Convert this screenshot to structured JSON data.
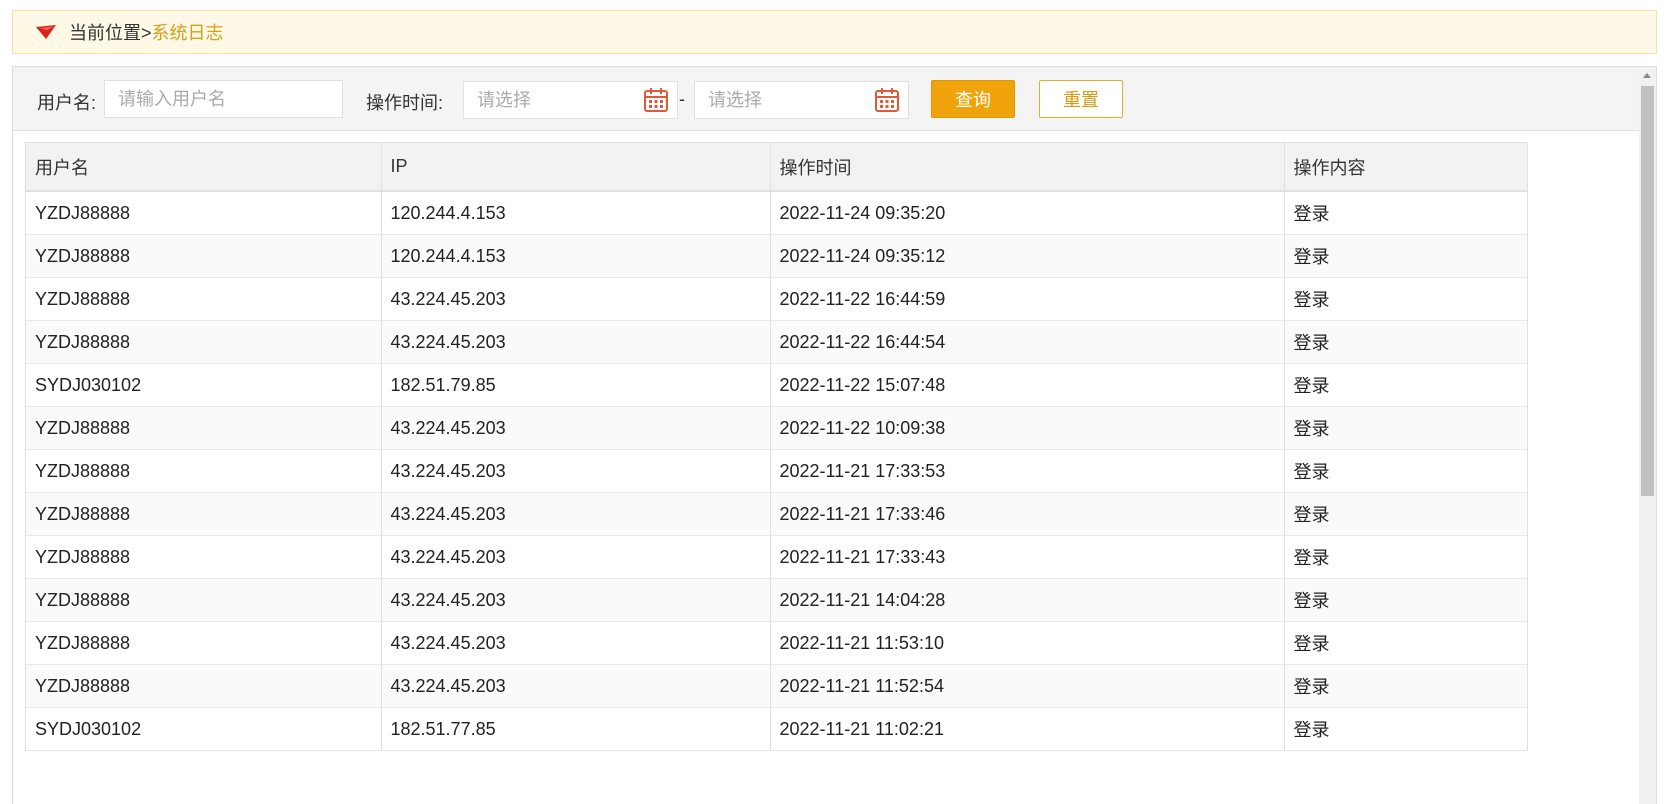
{
  "breadcrumb": {
    "prefix": "当前位置>",
    "current": "系统日志",
    "icon": "red-arrow-icon"
  },
  "search": {
    "username_label": "用户名:",
    "username_placeholder": "请输入用户名",
    "username_value": "",
    "time_label": "操作时间:",
    "start_placeholder": "请选择",
    "end_placeholder": "请选择",
    "separator": "-",
    "query_label": "查询",
    "reset_label": "重置"
  },
  "colors": {
    "accent": "#f0a30a",
    "breadcrumb_bg": "#fdf9e6",
    "breadcrumb_current": "#d4a017",
    "calendar_icon": "#e05a3a"
  },
  "table": {
    "headers": [
      "用户名",
      "IP",
      "操作时间",
      "操作内容"
    ],
    "rows": [
      [
        "YZDJ88888",
        "120.244.4.153",
        "2022-11-24 09:35:20",
        "登录"
      ],
      [
        "YZDJ88888",
        "120.244.4.153",
        "2022-11-24 09:35:12",
        "登录"
      ],
      [
        "YZDJ88888",
        "43.224.45.203",
        "2022-11-22 16:44:59",
        "登录"
      ],
      [
        "YZDJ88888",
        "43.224.45.203",
        "2022-11-22 16:44:54",
        "登录"
      ],
      [
        "SYDJ030102",
        "182.51.79.85",
        "2022-11-22 15:07:48",
        "登录"
      ],
      [
        "YZDJ88888",
        "43.224.45.203",
        "2022-11-22 10:09:38",
        "登录"
      ],
      [
        "YZDJ88888",
        "43.224.45.203",
        "2022-11-21 17:33:53",
        "登录"
      ],
      [
        "YZDJ88888",
        "43.224.45.203",
        "2022-11-21 17:33:46",
        "登录"
      ],
      [
        "YZDJ88888",
        "43.224.45.203",
        "2022-11-21 17:33:43",
        "登录"
      ],
      [
        "YZDJ88888",
        "43.224.45.203",
        "2022-11-21 14:04:28",
        "登录"
      ],
      [
        "YZDJ88888",
        "43.224.45.203",
        "2022-11-21 11:53:10",
        "登录"
      ],
      [
        "YZDJ88888",
        "43.224.45.203",
        "2022-11-21 11:52:54",
        "登录"
      ],
      [
        "SYDJ030102",
        "182.51.77.85",
        "2022-11-21 11:02:21",
        "登录"
      ]
    ]
  }
}
